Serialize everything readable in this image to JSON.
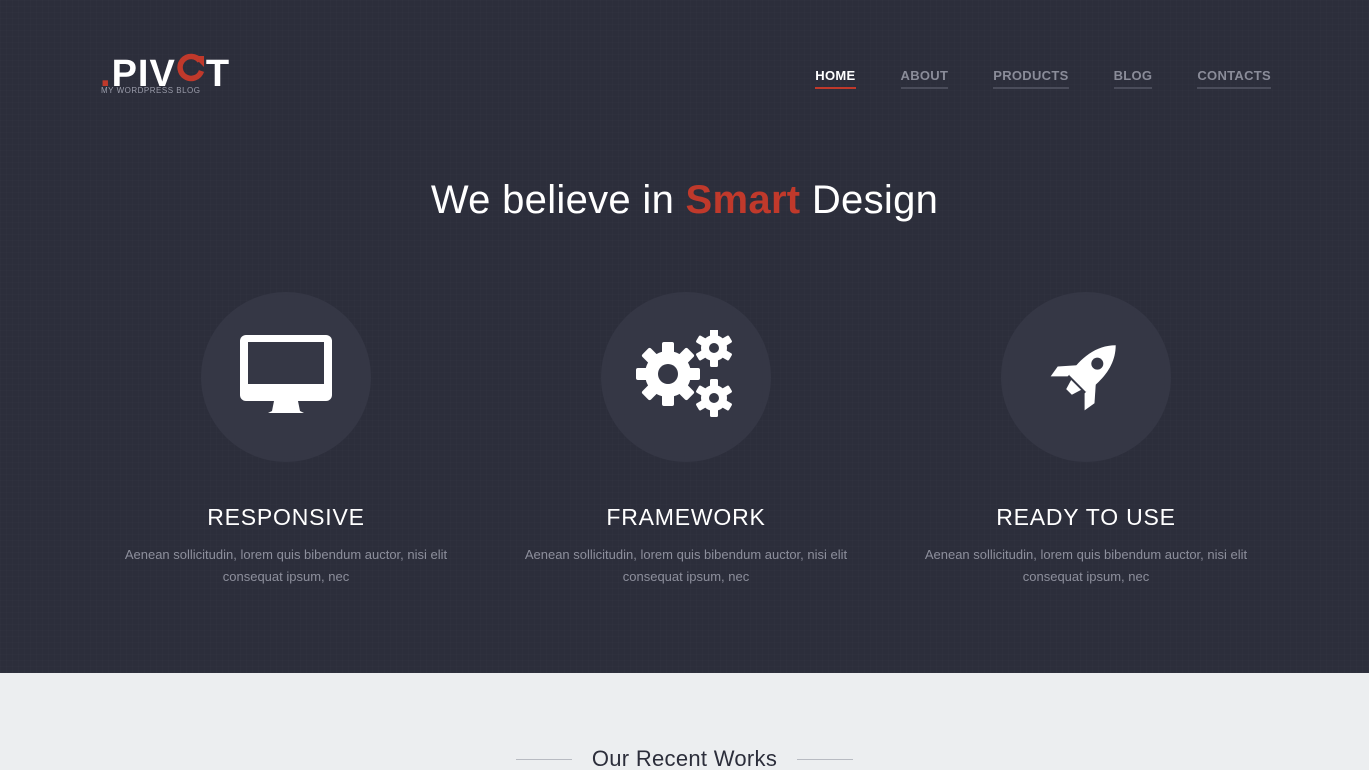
{
  "brand": {
    "logo_dot": ".",
    "logo_prefix": "PIV",
    "logo_suffix": "T",
    "tagline": "MY WORDPRESS BLOG",
    "accent_color": "#c0392b"
  },
  "nav": {
    "items": [
      {
        "label": "HOME",
        "active": true
      },
      {
        "label": "ABOUT",
        "active": false
      },
      {
        "label": "PRODUCTS",
        "active": false
      },
      {
        "label": "BLOG",
        "active": false
      },
      {
        "label": "CONTACTS",
        "active": false
      }
    ]
  },
  "hero": {
    "headline_start": "We believe in ",
    "headline_accent": "Smart",
    "headline_end": " Design",
    "background_color": "#2c2e3b"
  },
  "features": [
    {
      "icon": "monitor-icon",
      "title": "RESPONSIVE",
      "text": "Aenean sollicitudin, lorem quis bibendum auctor, nisi elit consequat ipsum, nec"
    },
    {
      "icon": "gears-icon",
      "title": "FRAMEWORK",
      "text": "Aenean sollicitudin, lorem quis bibendum auctor, nisi elit consequat ipsum, nec"
    },
    {
      "icon": "rocket-icon",
      "title": "READY TO USE",
      "text": "Aenean sollicitudin, lorem quis bibendum auctor, nisi elit consequat ipsum, nec"
    }
  ],
  "works": {
    "title": "Our Recent Works"
  }
}
